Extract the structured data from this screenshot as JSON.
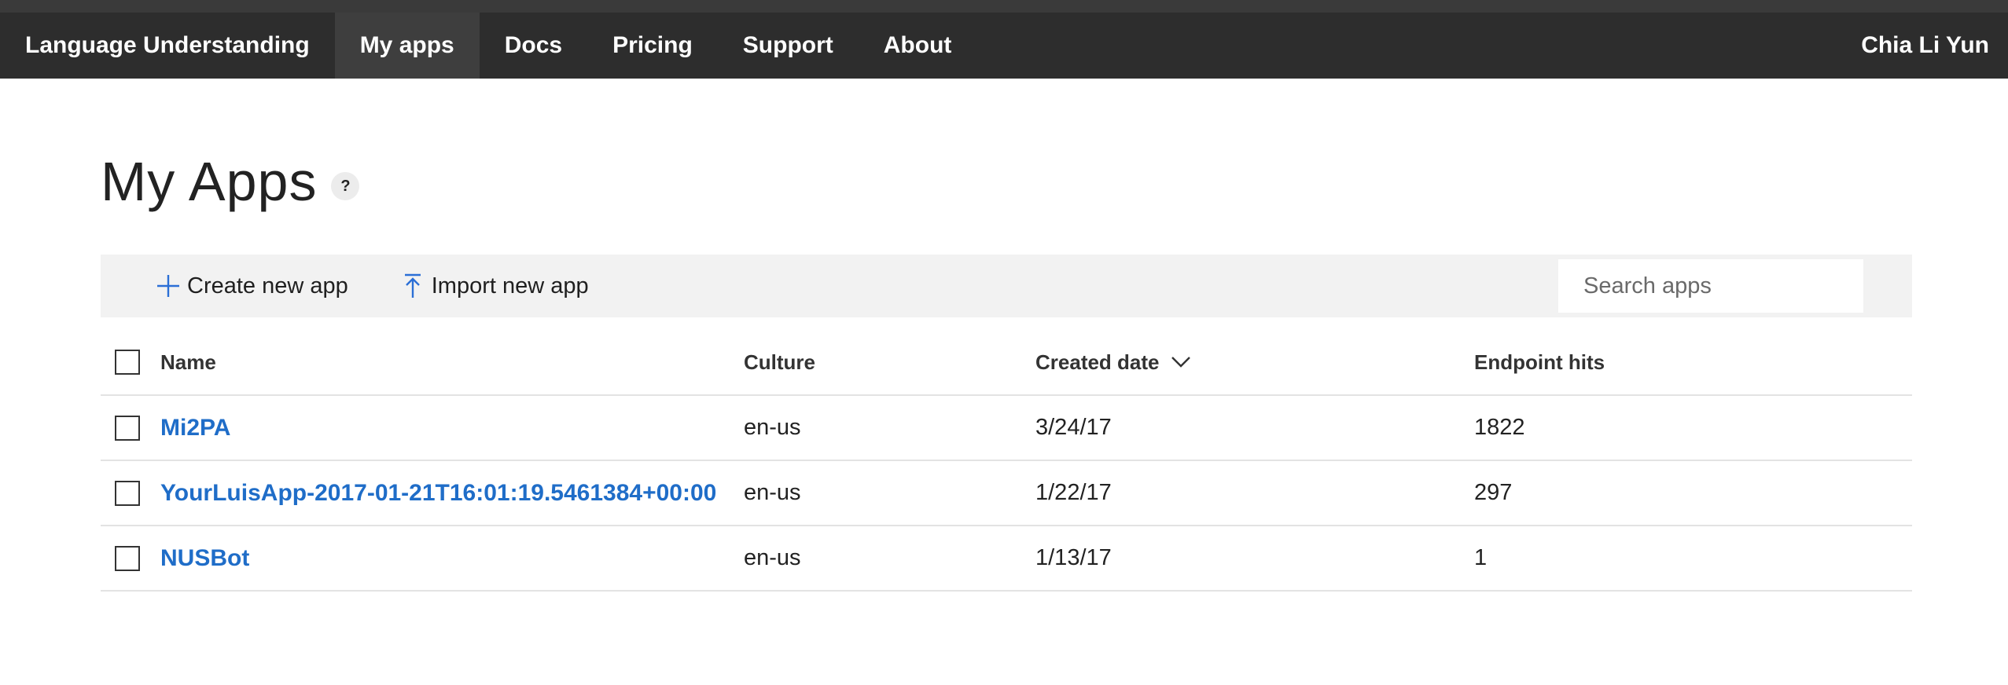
{
  "nav": {
    "brand": "Language Understanding",
    "items": [
      {
        "label": "My apps",
        "active": true
      },
      {
        "label": "Docs",
        "active": false
      },
      {
        "label": "Pricing",
        "active": false
      },
      {
        "label": "Support",
        "active": false
      },
      {
        "label": "About",
        "active": false
      }
    ],
    "user": "Chia Li Yun"
  },
  "page": {
    "title": "My Apps",
    "help": "?"
  },
  "toolbar": {
    "create_label": "Create new app",
    "import_label": "Import new app",
    "search_placeholder": "Search apps",
    "icons": {
      "create": "plus-icon",
      "import": "upload-icon"
    }
  },
  "table": {
    "columns": {
      "name": "Name",
      "culture": "Culture",
      "created": "Created date",
      "endpoint": "Endpoint hits"
    },
    "sort_icon": "chevron-down-icon",
    "rows": [
      {
        "name": "Mi2PA",
        "culture": "en-us",
        "created": "3/24/17",
        "endpoint": "1822"
      },
      {
        "name": "YourLuisApp-2017-01-21T16:01:19.5461384+00:00",
        "culture": "en-us",
        "created": "1/22/17",
        "endpoint": "297"
      },
      {
        "name": "NUSBot",
        "culture": "en-us",
        "created": "1/13/17",
        "endpoint": "1"
      }
    ]
  },
  "colors": {
    "navbar": "#2d2d2d",
    "nav_active": "#3e3e3e",
    "link": "#1f6dc8",
    "toolbar": "#f2f2f2",
    "icon_blue": "#2b6fd6"
  }
}
